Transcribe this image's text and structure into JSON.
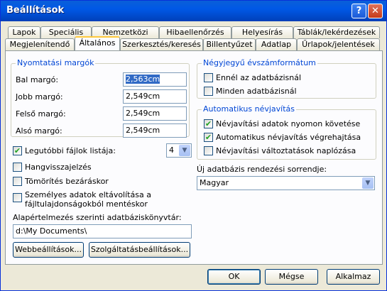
{
  "window": {
    "title": "Beállítások"
  },
  "tabs": {
    "row1": [
      "Lapok",
      "Speciális",
      "Nemzetközi",
      "Hibaellenőrzés",
      "Helyesírás",
      "Táblák/lekérdezések"
    ],
    "row2": [
      "Megjelenítendő",
      "Általános",
      "Szerkesztés/keresés",
      "Billentyűzet",
      "Adatlap",
      "Űrlapok/jelentések"
    ],
    "active": "Általános"
  },
  "margins": {
    "title": "Nyomtatási margók",
    "left_label": "Bal margó:",
    "left_value": "2,563cm",
    "right_label": "Jobb margó:",
    "right_value": "2,549cm",
    "top_label": "Felső margó:",
    "top_value": "2,549cm",
    "bottom_label": "Alsó margó:",
    "bottom_value": "2,549cm"
  },
  "recent_files": {
    "label": "Legutóbbi fájlok listája:",
    "checked": true,
    "count": "4"
  },
  "options": {
    "feedback_label": "Hangvisszajelzés",
    "feedback_checked": false,
    "compact_label": "Tömörítés bezáráskor",
    "compact_checked": false,
    "personal_label_1": "Személyes adatok eltávolítása a",
    "personal_label_2": "fájltulajdonságokból mentéskor",
    "personal_checked": false
  },
  "default_folder": {
    "label": "Alapértelmezés szerinti adatbáziskönyvtár:",
    "value": "d:\\My Documents\\"
  },
  "year_format": {
    "title": "Négyjegyű évszámformátum",
    "this_db": "Ennél az adatbázisnál",
    "this_db_checked": false,
    "all_db": "Minden adatbázisnál",
    "all_db_checked": false
  },
  "name_autocorrect": {
    "title": "Automatikus névjavítás",
    "track": "Névjavítási adatok nyomon követése",
    "track_checked": true,
    "perform": "Automatikus névjavítás végrehajtása",
    "perform_checked": true,
    "log": "Névjavítási változtatások naplózása",
    "log_checked": false
  },
  "sort_order": {
    "label": "Új adatbázis rendezési sorrendje:",
    "value": "Magyar"
  },
  "panel_buttons": {
    "web": "Webbeállítások...",
    "service": "Szolgáltatásbeállítások..."
  },
  "dialog_buttons": {
    "ok": "OK",
    "cancel": "Mégse",
    "apply": "Alkalmaz"
  },
  "icons": {
    "help": "help-icon",
    "close": "close-icon",
    "check": "checkmark-icon",
    "dropdown": "chevron-down-icon"
  }
}
